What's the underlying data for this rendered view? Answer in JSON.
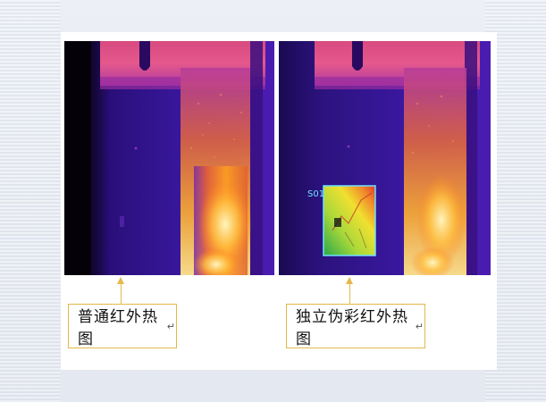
{
  "images": {
    "left": {
      "caption": "普通红外热图",
      "return_mark": "↵"
    },
    "right": {
      "caption": "独立伪彩红外热图",
      "return_mark": "↵",
      "roi_label": "S01"
    }
  },
  "colors": {
    "accent_border": "#e4b84a",
    "roi_border": "#6fe3ff",
    "palette": [
      "#0a0312",
      "#2a0a78",
      "#5a1fb0",
      "#a02aa0",
      "#e0502a",
      "#ffa21a",
      "#fff3a0"
    ]
  },
  "icons": {
    "arrow": "up-arrow-icon",
    "return": "return-icon"
  }
}
